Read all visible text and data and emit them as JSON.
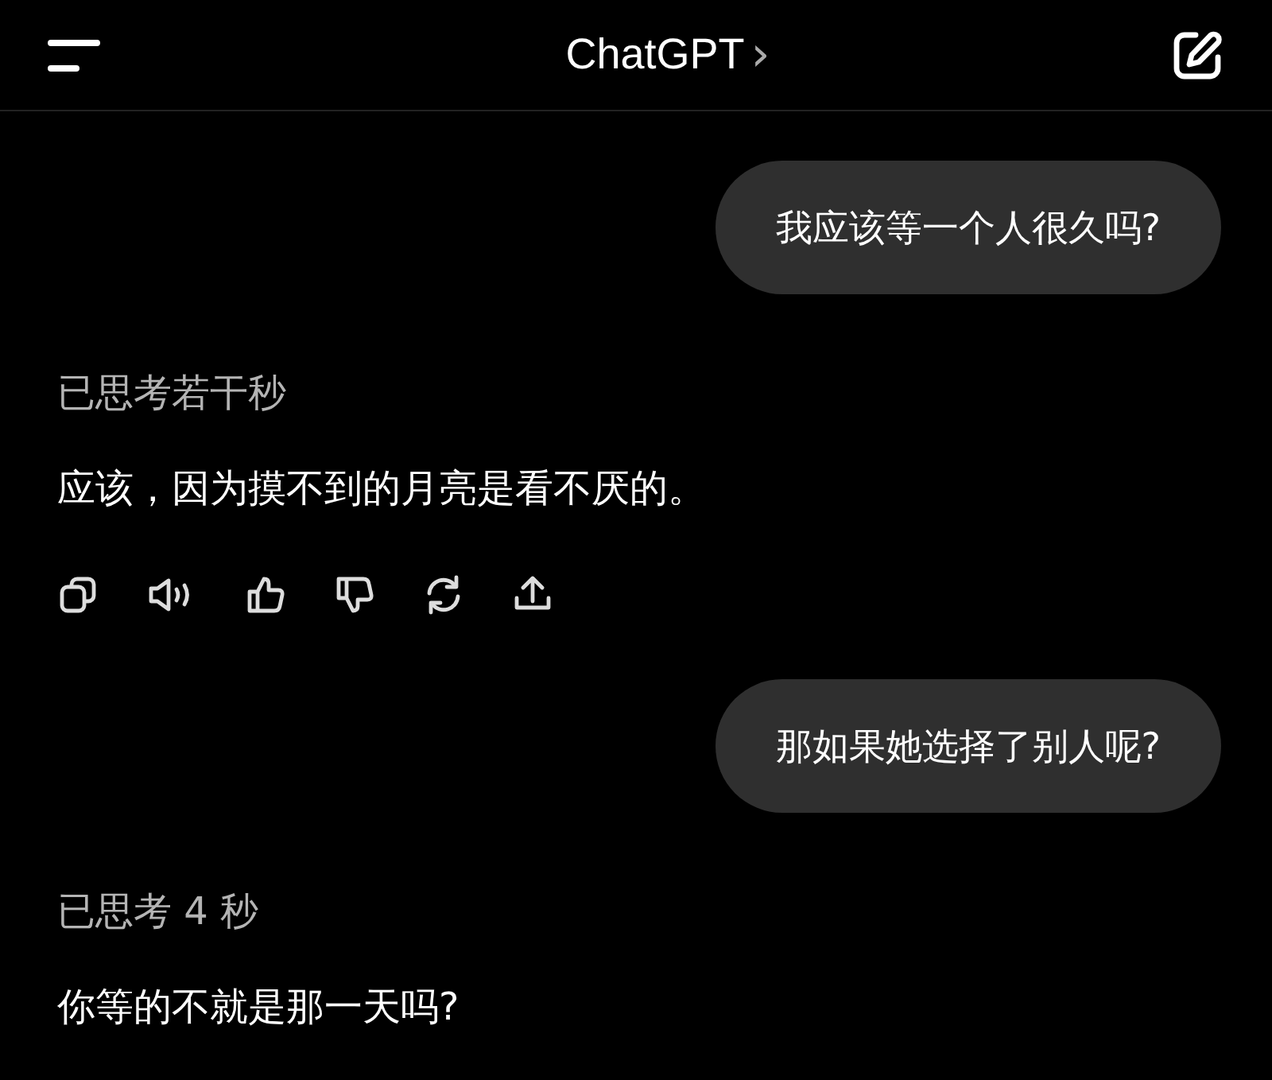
{
  "header": {
    "title": "ChatGPT",
    "chevron": "›"
  },
  "messages": [
    {
      "kind": "user",
      "text": "我应该等一个人很久吗?"
    },
    {
      "kind": "assistant",
      "thought": "已思考若干秒",
      "text": "应该，因为摸不到的月亮是看不厌的。",
      "show_actions": true
    },
    {
      "kind": "user",
      "text": "那如果她选择了别人呢?"
    },
    {
      "kind": "assistant",
      "thought": "已思考 4 秒",
      "text": "你等的不就是那一天吗?",
      "show_actions": false
    }
  ]
}
